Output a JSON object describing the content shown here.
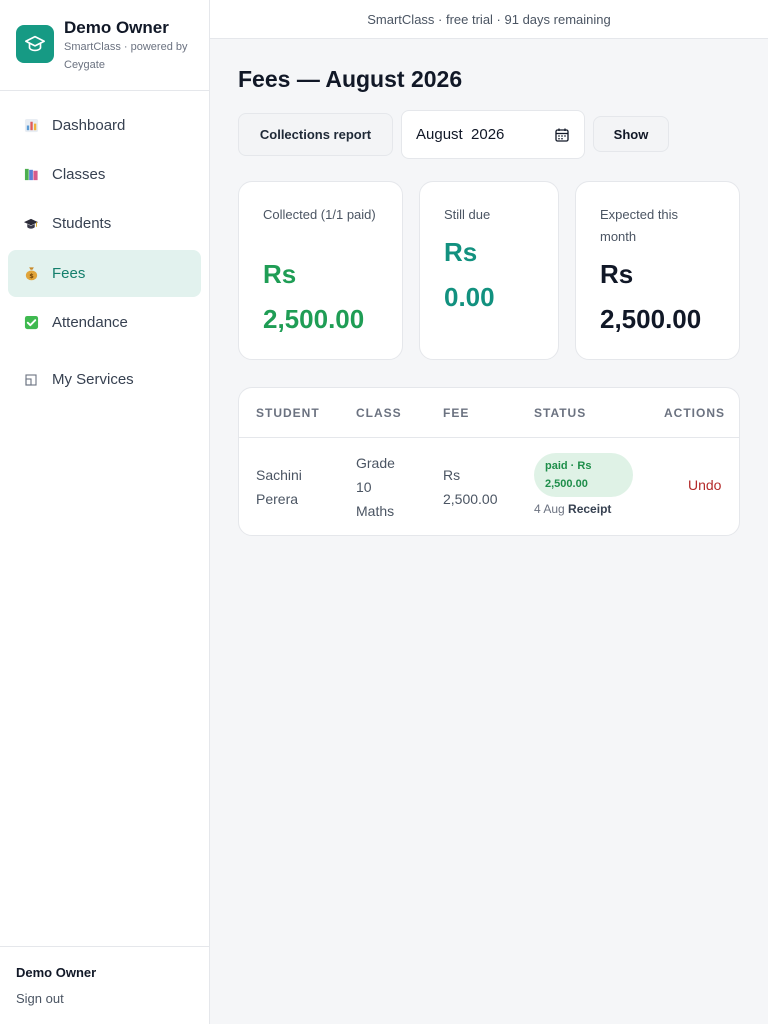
{
  "brand": {
    "name": "Demo Owner",
    "subtitle": "SmartClass · powered by Ceygate",
    "logo_icon": "graduation-cap-icon"
  },
  "nav": {
    "items": [
      {
        "label": "Dashboard",
        "icon": "bar-chart-icon",
        "active": false
      },
      {
        "label": "Classes",
        "icon": "books-icon",
        "active": false
      },
      {
        "label": "Students",
        "icon": "graduation-cap-icon",
        "active": false
      },
      {
        "label": "Fees",
        "icon": "money-bag-icon",
        "active": true
      },
      {
        "label": "Attendance",
        "icon": "checkbox-icon",
        "active": false
      },
      {
        "label": "My Services",
        "icon": "services-icon",
        "active": false
      }
    ]
  },
  "footer": {
    "user": "Demo Owner",
    "signout": "Sign out"
  },
  "banner": {
    "text": "SmartClass · free trial · 91 days remaining"
  },
  "page": {
    "title": "Fees — August 2026"
  },
  "toolbar": {
    "report_label": "Collections report",
    "month_value": "August  2026",
    "show_label": "Show"
  },
  "stats": [
    {
      "label": "Collected (1/1 paid)",
      "currency": "Rs",
      "amount": "2,500.00",
      "color": "#1f9d55"
    },
    {
      "label": "Still due",
      "currency": "Rs",
      "amount": "0.00",
      "color": "#12917f"
    },
    {
      "label": "Expected this month",
      "currency": "Rs",
      "amount": "2,500.00",
      "color": "#111827"
    }
  ],
  "table": {
    "headers": [
      "STUDENT",
      "CLASS",
      "FEE",
      "STATUS",
      "ACTIONS"
    ],
    "rows": [
      {
        "student": "Sachini Perera",
        "class": "Grade 10 Maths",
        "fee": "Rs 2,500.00",
        "status": "paid · Rs 2,500.00",
        "paid_date": "4 Aug",
        "receipt_label": "Receipt",
        "action": "Undo"
      }
    ]
  },
  "colors": {
    "accent": "#169a84",
    "active_nav_bg": "#e2f2ee",
    "paid_pill_bg": "#dff2e6",
    "danger": "#b42a2a"
  }
}
